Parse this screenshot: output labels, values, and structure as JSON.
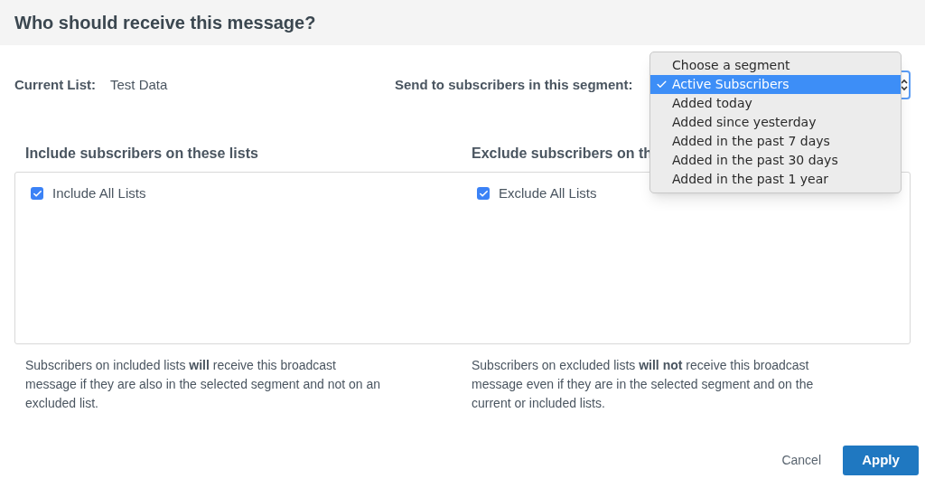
{
  "header": {
    "title": "Who should receive this message?"
  },
  "current_list": {
    "label": "Current List:",
    "value": "Test Data"
  },
  "segment": {
    "label": "Send to subscribers in this segment:",
    "menu": [
      {
        "label": "Choose a segment",
        "selected": false
      },
      {
        "label": "Active Subscribers",
        "selected": true
      },
      {
        "label": "Added today",
        "selected": false
      },
      {
        "label": "Added since yesterday",
        "selected": false
      },
      {
        "label": "Added in the past 7 days",
        "selected": false
      },
      {
        "label": "Added in the past 30 days",
        "selected": false
      },
      {
        "label": "Added in the past 1 year",
        "selected": false
      }
    ]
  },
  "columns": [
    {
      "heading": "Include subscribers on these lists",
      "items": [
        {
          "label": "Include All Lists",
          "checked": true
        }
      ],
      "note": "Subscribers on included lists **will** receive this broadcast message if they are also in the selected segment and not on an excluded list."
    },
    {
      "heading": "Exclude subscribers on th",
      "items": [
        {
          "label": "Exclude All Lists",
          "checked": true
        }
      ],
      "note": "Subscribers on excluded lists **will not** receive this broadcast message even if they are in the selected segment and on the current or included lists."
    }
  ],
  "buttons": [
    {
      "label": "Cancel",
      "kind": "link"
    },
    {
      "label": "Apply",
      "kind": "primary"
    }
  ]
}
